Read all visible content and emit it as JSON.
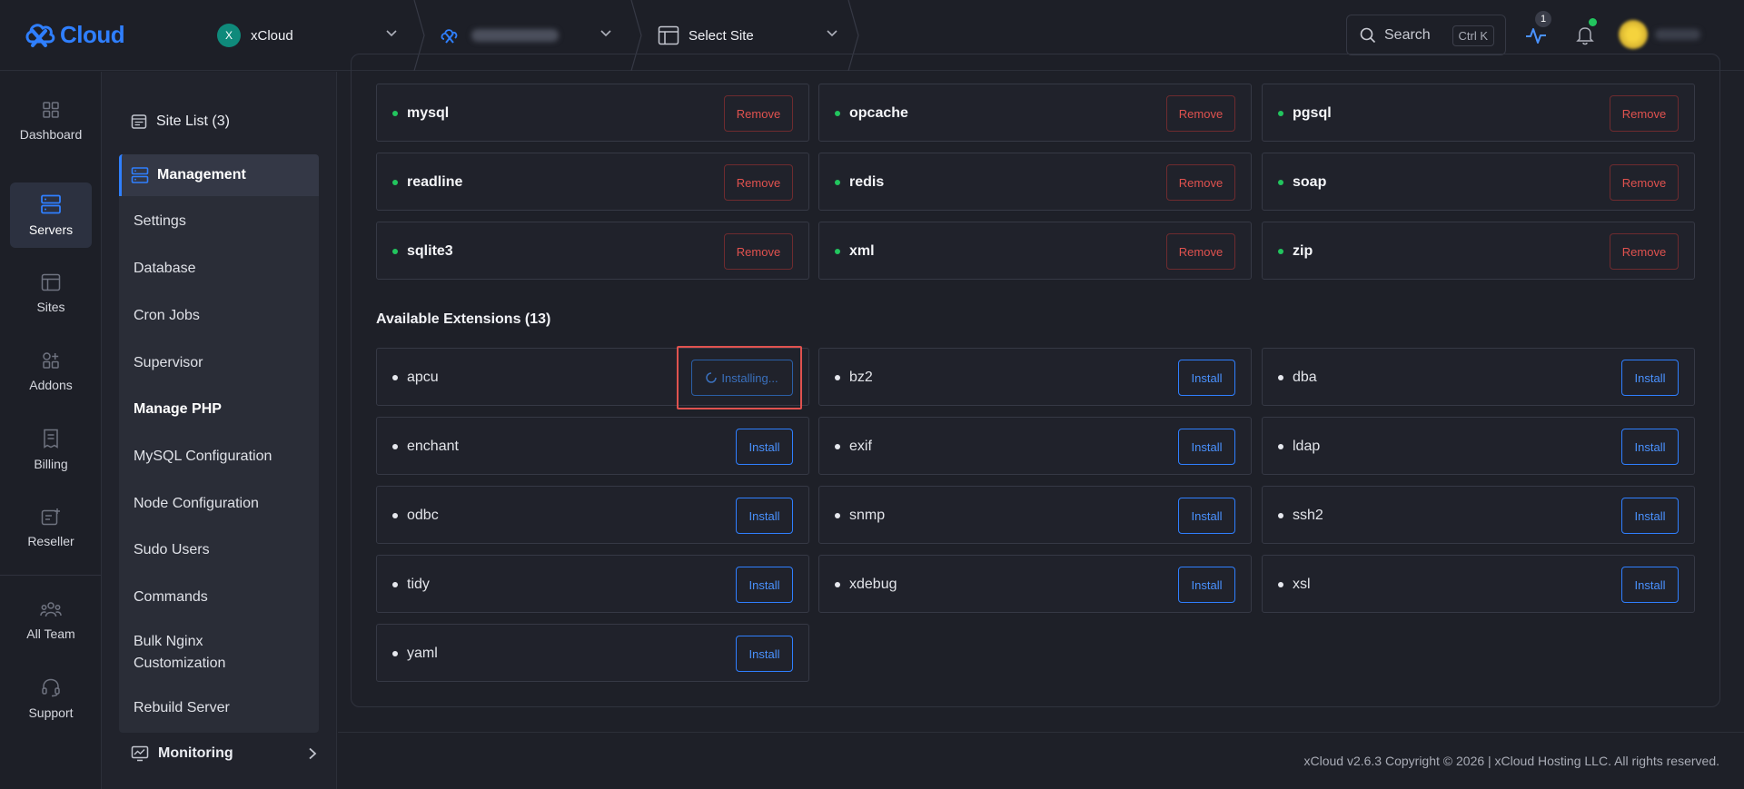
{
  "brand": {
    "name": "Cloud",
    "accent": "#2f7fff"
  },
  "topbar": {
    "workspace": {
      "initial": "X",
      "name": "xCloud"
    },
    "server_select": {
      "label": ""
    },
    "site_select": {
      "label": "Select Site"
    },
    "search": {
      "label": "Search",
      "shortcut": "Ctrl K"
    },
    "activity_count": "1"
  },
  "rail": [
    {
      "label": "Dashboard",
      "icon": "dashboard-icon"
    },
    {
      "label": "Servers",
      "icon": "servers-icon",
      "active": true
    },
    {
      "label": "Sites",
      "icon": "sites-icon"
    },
    {
      "label": "Addons",
      "icon": "addons-icon"
    },
    {
      "label": "Billing",
      "icon": "billing-icon"
    },
    {
      "label": "Reseller",
      "icon": "reseller-icon"
    },
    {
      "label": "All Team",
      "icon": "team-icon"
    },
    {
      "label": "Support",
      "icon": "support-icon"
    }
  ],
  "subnav": {
    "site_list": "Site List (3)",
    "management": "Management",
    "items": [
      "Settings",
      "Database",
      "Cron Jobs",
      "Supervisor",
      "Manage PHP",
      "MySQL Configuration",
      "Node Configuration",
      "Sudo Users",
      "Commands",
      "Bulk Nginx Customization",
      "Rebuild Server"
    ],
    "monitoring": "Monitoring"
  },
  "installed": [
    {
      "name": "mysql",
      "action": "Remove"
    },
    {
      "name": "opcache",
      "action": "Remove"
    },
    {
      "name": "pgsql",
      "action": "Remove"
    },
    {
      "name": "readline",
      "action": "Remove"
    },
    {
      "name": "redis",
      "action": "Remove"
    },
    {
      "name": "soap",
      "action": "Remove"
    },
    {
      "name": "sqlite3",
      "action": "Remove"
    },
    {
      "name": "xml",
      "action": "Remove"
    },
    {
      "name": "zip",
      "action": "Remove"
    }
  ],
  "available_title": "Available Extensions (13)",
  "available": [
    {
      "name": "apcu",
      "action": "Installing..."
    },
    {
      "name": "bz2",
      "action": "Install"
    },
    {
      "name": "dba",
      "action": "Install"
    },
    {
      "name": "enchant",
      "action": "Install"
    },
    {
      "name": "exif",
      "action": "Install"
    },
    {
      "name": "ldap",
      "action": "Install"
    },
    {
      "name": "odbc",
      "action": "Install"
    },
    {
      "name": "snmp",
      "action": "Install"
    },
    {
      "name": "ssh2",
      "action": "Install"
    },
    {
      "name": "tidy",
      "action": "Install"
    },
    {
      "name": "xdebug",
      "action": "Install"
    },
    {
      "name": "xsl",
      "action": "Install"
    },
    {
      "name": "yaml",
      "action": "Install"
    }
  ],
  "colors": {
    "installed_dot": "#22c55e",
    "available_dot": "#e6e8ee",
    "remove": "#e0524f",
    "install": "#2f7fff"
  },
  "footer": "xCloud v2.6.3 Copyright © 2026 | xCloud Hosting LLC. All rights reserved."
}
